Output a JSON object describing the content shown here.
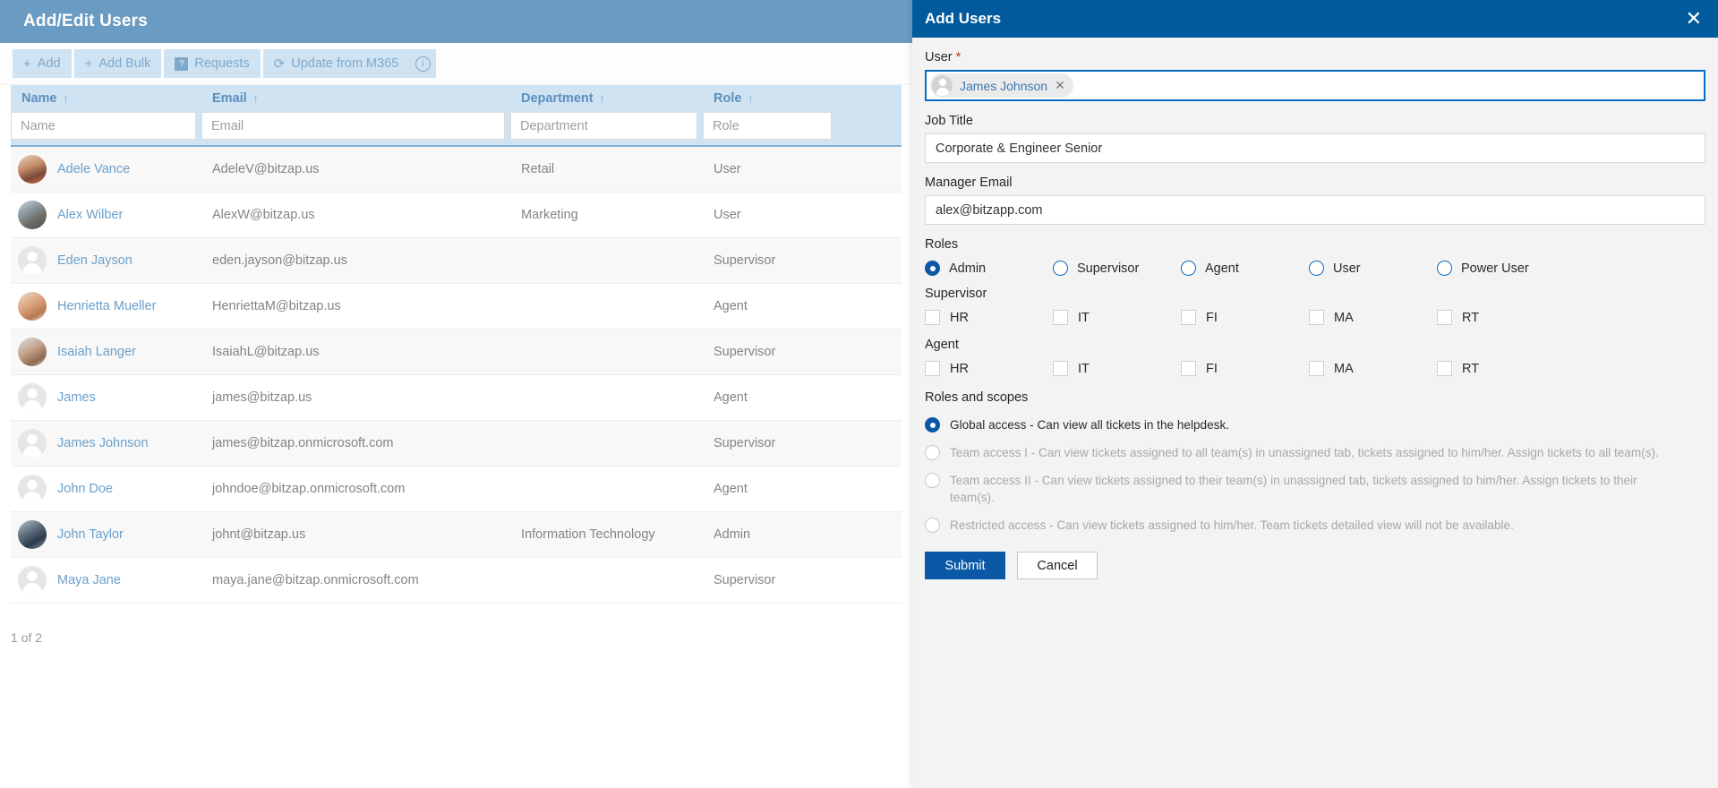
{
  "left_page": {
    "header": {
      "title": "Add/Edit Users"
    },
    "toolbar": {
      "add_label": "Add",
      "add_bulk_label": "Add Bulk",
      "requests_label": "Requests",
      "update_m365_label": "Update from M365",
      "requests_icon_glyph": "?",
      "plus_glyph": "+",
      "refresh_glyph": "⟳",
      "info_glyph": "i"
    },
    "table": {
      "columns": [
        {
          "label": "Name",
          "sort_glyph": "↑",
          "placeholder": "Name"
        },
        {
          "label": "Email",
          "sort_glyph": "↑",
          "placeholder": "Email"
        },
        {
          "label": "Department",
          "sort_glyph": "↑",
          "placeholder": "Department"
        },
        {
          "label": "Role",
          "sort_glyph": "↑",
          "placeholder": "Role"
        }
      ],
      "rows": [
        {
          "name": "Adele Vance",
          "email": "AdeleV@bitzap.us",
          "department": "Retail",
          "role": "User",
          "avatar": "photo-a"
        },
        {
          "name": "Alex Wilber",
          "email": "AlexW@bitzap.us",
          "department": "Marketing",
          "role": "User",
          "avatar": "photo-b"
        },
        {
          "name": "Eden Jayson",
          "email": "eden.jayson@bitzap.us",
          "department": "",
          "role": "Supervisor",
          "avatar": "generic"
        },
        {
          "name": "Henrietta Mueller",
          "email": "HenriettaM@bitzap.us",
          "department": "",
          "role": "Agent",
          "avatar": "photo-c"
        },
        {
          "name": "Isaiah Langer",
          "email": "IsaiahL@bitzap.us",
          "department": "",
          "role": "Supervisor",
          "avatar": "photo-d"
        },
        {
          "name": "James",
          "email": "james@bitzap.us",
          "department": "",
          "role": "Agent",
          "avatar": "generic"
        },
        {
          "name": "James Johnson",
          "email": "james@bitzap.onmicrosoft.com",
          "department": "",
          "role": "Supervisor",
          "avatar": "generic"
        },
        {
          "name": "John Doe",
          "email": "johndoe@bitzap.onmicrosoft.com",
          "department": "",
          "role": "Agent",
          "avatar": "generic"
        },
        {
          "name": "John Taylor",
          "email": "johnt@bitzap.us",
          "department": "Information Technology",
          "role": "Admin",
          "avatar": "photo-e"
        },
        {
          "name": "Maya Jane",
          "email": "maya.jane@bitzap.onmicrosoft.com",
          "department": "",
          "role": "Supervisor",
          "avatar": "generic"
        }
      ]
    },
    "pager": {
      "text": "1 of 2"
    }
  },
  "modal": {
    "title": "Add Users",
    "close_glyph": "✕",
    "user_field": {
      "label": "User",
      "required_marker": "*",
      "chip_name": "James Johnson",
      "chip_remove_glyph": "✕"
    },
    "job_title": {
      "label": "Job Title",
      "value": "Corporate & Engineer Senior"
    },
    "manager_email": {
      "label": "Manager Email",
      "value": "alex@bitzapp.com"
    },
    "roles": {
      "label": "Roles",
      "options": [
        {
          "label": "Admin",
          "checked": true
        },
        {
          "label": "Supervisor",
          "checked": false
        },
        {
          "label": "Agent",
          "checked": false
        },
        {
          "label": "User",
          "checked": false
        },
        {
          "label": "Power User",
          "checked": false
        }
      ]
    },
    "supervisor": {
      "label": "Supervisor",
      "options": [
        {
          "label": "HR",
          "checked": false
        },
        {
          "label": "IT",
          "checked": false
        },
        {
          "label": "FI",
          "checked": false
        },
        {
          "label": "MA",
          "checked": false
        },
        {
          "label": "RT",
          "checked": false
        }
      ]
    },
    "agent": {
      "label": "Agent",
      "options": [
        {
          "label": "HR",
          "checked": false
        },
        {
          "label": "IT",
          "checked": false
        },
        {
          "label": "FI",
          "checked": false
        },
        {
          "label": "MA",
          "checked": false
        },
        {
          "label": "RT",
          "checked": false
        }
      ]
    },
    "scopes": {
      "label": "Roles and scopes",
      "options": [
        {
          "text": "Global access - Can view all tickets in the helpdesk.",
          "checked": true,
          "disabled": false
        },
        {
          "text": "Team access I - Can view tickets assigned to all team(s) in unassigned tab, tickets assigned to him/her. Assign tickets to all team(s).",
          "checked": false,
          "disabled": true
        },
        {
          "text": "Team access II - Can view tickets assigned to their team(s) in unassigned tab, tickets assigned to him/her. Assign tickets to their team(s).",
          "checked": false,
          "disabled": true
        },
        {
          "text": "Restricted access - Can view tickets assigned to him/her. Team tickets detailed view will not be available.",
          "checked": false,
          "disabled": true
        }
      ]
    },
    "buttons": {
      "submit": "Submit",
      "cancel": "Cancel"
    }
  },
  "colors": {
    "page_header_blue": "#6a9bc3",
    "modal_header_blue": "#015a9c",
    "toolbar_chip_blue": "#cfe3f2",
    "accent_blue": "#0a58a6",
    "link_blue": "#6ba0cb"
  }
}
